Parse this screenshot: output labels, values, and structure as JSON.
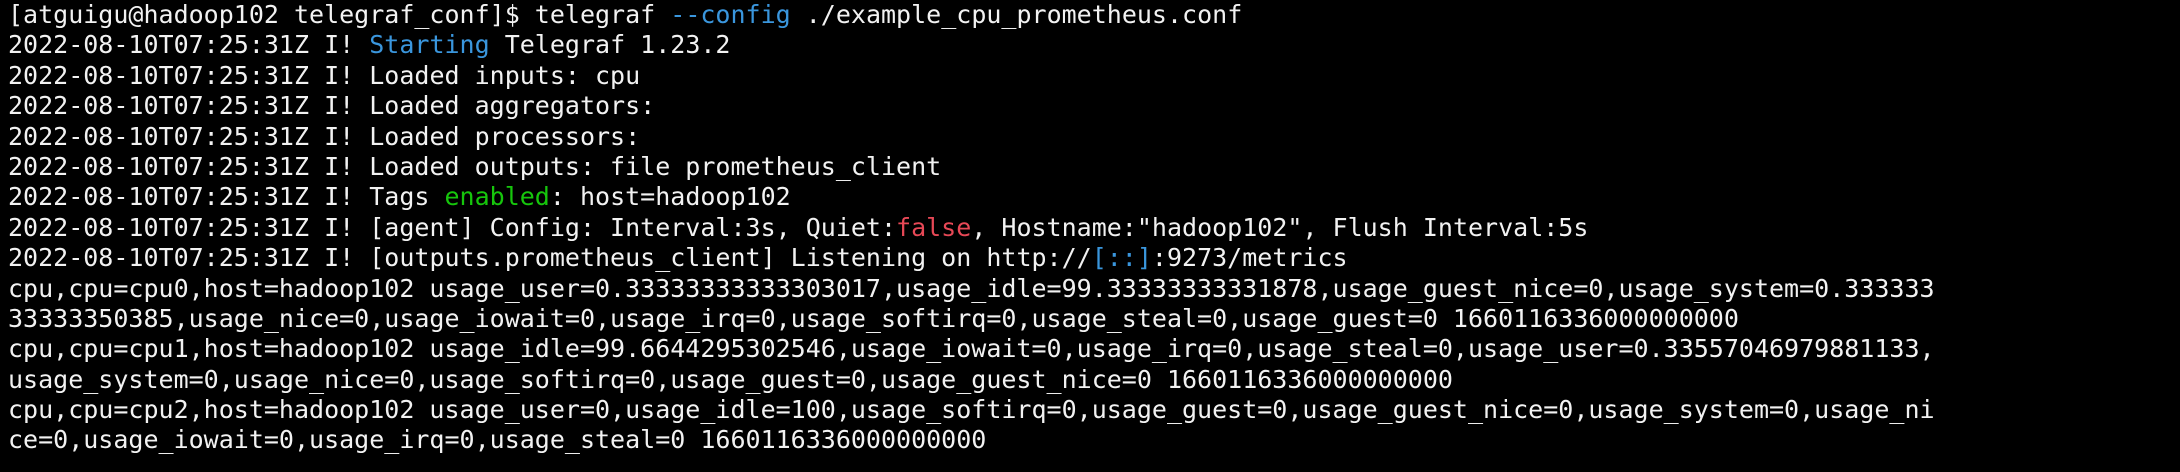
{
  "colors": {
    "background": "#000000",
    "foreground": "#f2f2f2",
    "cyan": "#3a96dd",
    "green": "#16c60c",
    "red": "#e74856"
  },
  "terminal": {
    "prompt": "[atguigu@hadoop102 telegraf_conf]$ ",
    "command": "telegraf",
    "command_flag": "--config",
    "command_arg": " ./example_cpu_prometheus.conf",
    "log_prefix": "2022-08-10T07:25:31Z I! ",
    "log_lines": [
      {
        "pre": "",
        "hl": "Starting",
        "post": " Telegraf 1.23.2"
      },
      {
        "pre": "Loaded inputs: cpu"
      },
      {
        "pre": "Loaded aggregators:"
      },
      {
        "pre": "Loaded processors:"
      },
      {
        "pre": "Loaded outputs: file prometheus_client"
      },
      {
        "pre": "Tags ",
        "hl": "enabled",
        "post": ": host=hadoop102"
      },
      {
        "pre": "[agent] Config: Interval:3s, Quiet:",
        "hl": "false",
        "post": ", Hostname:\"hadoop102\", Flush Interval:5s"
      },
      {
        "pre": "[outputs.prometheus_client] Listening on http://",
        "hl": "[::]",
        "post": ":9273/metrics"
      }
    ],
    "output_lines": [
      "cpu,cpu=cpu0,host=hadoop102 usage_user=0.33333333333303017,usage_idle=99.33333333331878,usage_guest_nice=0,usage_system=0.333333",
      "33333350385,usage_nice=0,usage_iowait=0,usage_irq=0,usage_softirq=0,usage_steal=0,usage_guest=0 1660116336000000000",
      "cpu,cpu=cpu1,host=hadoop102 usage_idle=99.6644295302546,usage_iowait=0,usage_irq=0,usage_steal=0,usage_user=0.33557046979881133,",
      "usage_system=0,usage_nice=0,usage_softirq=0,usage_guest=0,usage_guest_nice=0 1660116336000000000",
      "cpu,cpu=cpu2,host=hadoop102 usage_user=0,usage_idle=100,usage_softirq=0,usage_guest=0,usage_guest_nice=0,usage_system=0,usage_ni",
      "ce=0,usage_iowait=0,usage_irq=0,usage_steal=0 1660116336000000000"
    ]
  }
}
